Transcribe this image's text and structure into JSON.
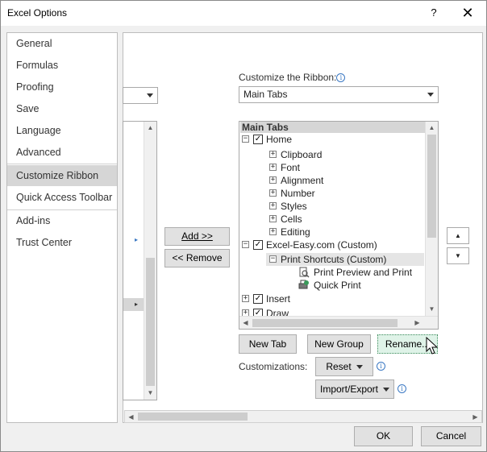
{
  "window": {
    "title": "Excel Options",
    "help": "?",
    "close": "✕"
  },
  "nav": {
    "items": [
      {
        "label": "General"
      },
      {
        "label": "Formulas"
      },
      {
        "label": "Proofing"
      },
      {
        "label": "Save"
      },
      {
        "label": "Language"
      },
      {
        "label": "Advanced"
      },
      {
        "label": "Customize Ribbon"
      },
      {
        "label": "Quick Access Toolbar"
      },
      {
        "label": "Add-ins"
      },
      {
        "label": "Trust Center"
      }
    ],
    "selected": "Customize Ribbon"
  },
  "customize": {
    "label": "Customize the Ribbon:",
    "dropdown_value": "Main Tabs",
    "tree_header": "Main Tabs",
    "tree": [
      {
        "label": "Home",
        "expander": "⊟",
        "checked": true
      },
      {
        "label": "Clipboard",
        "expander": "⊞"
      },
      {
        "label": "Font",
        "expander": "⊞"
      },
      {
        "label": "Alignment",
        "expander": "⊞"
      },
      {
        "label": "Number",
        "expander": "⊞"
      },
      {
        "label": "Styles",
        "expander": "⊞"
      },
      {
        "label": "Cells",
        "expander": "⊞"
      },
      {
        "label": "Editing",
        "expander": "⊞"
      },
      {
        "label": "Excel-Easy.com (Custom)",
        "expander": "⊟",
        "checked": true
      },
      {
        "label": "Print Shortcuts (Custom)",
        "expander": "⊟"
      },
      {
        "label": "Print Preview and Print"
      },
      {
        "label": "Quick Print"
      },
      {
        "label": "Insert",
        "expander": "⊞",
        "checked": true
      },
      {
        "label": "Draw",
        "expander": "⊞",
        "checked": true
      }
    ]
  },
  "buttons": {
    "add": "Add >>",
    "remove": "<< Remove",
    "new_tab": "New Tab",
    "new_group": "New Group",
    "rename": "Rename...",
    "reset": "Reset",
    "import_export": "Import/Export",
    "ok": "OK",
    "cancel": "Cancel"
  },
  "customizations_label": "Customizations:",
  "colors": {
    "selected_nav": "#d6d6d6",
    "accent": "#3a78c3",
    "rename_highlight": "#dff3e8"
  }
}
